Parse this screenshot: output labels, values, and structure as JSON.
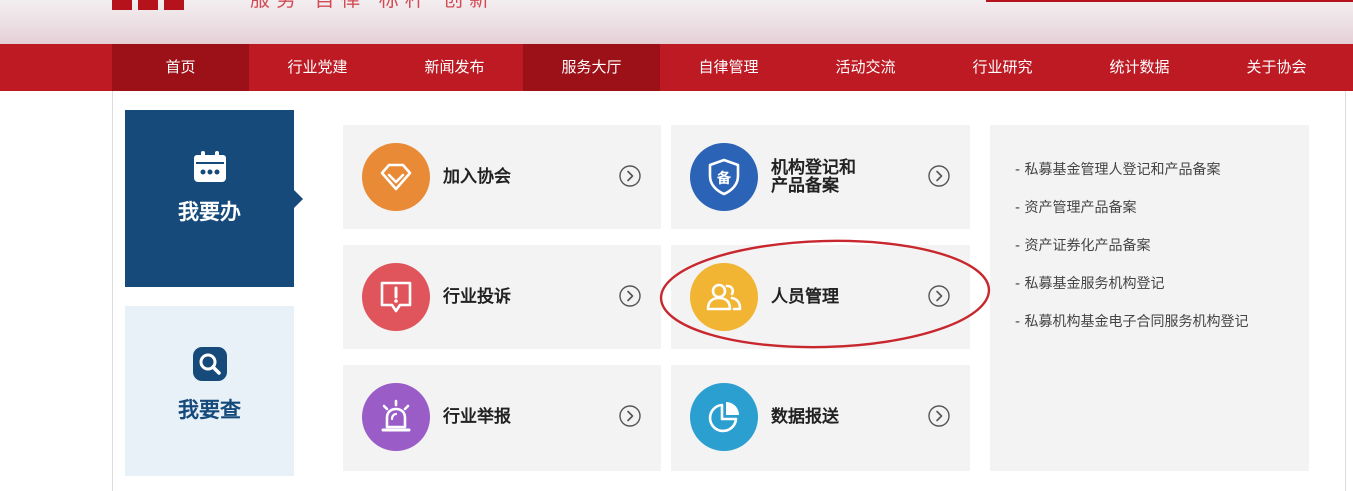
{
  "banner": {
    "slogan": "服务 自律 标杆 创新"
  },
  "nav": {
    "items": [
      {
        "label": "首页"
      },
      {
        "label": "行业党建"
      },
      {
        "label": "新闻发布"
      },
      {
        "label": "服务大厅"
      },
      {
        "label": "自律管理"
      },
      {
        "label": "活动交流"
      },
      {
        "label": "行业研究"
      },
      {
        "label": "统计数据"
      },
      {
        "label": "关于协会"
      }
    ]
  },
  "side_tabs": {
    "todo": {
      "label": "我要办",
      "icon": "calendar-icon"
    },
    "query": {
      "label": "我要查",
      "icon": "search-icon"
    }
  },
  "cards": {
    "join": {
      "label": "加入协会",
      "icon": "diamond-icon",
      "color": "#e98a37"
    },
    "registration": {
      "label_line1": "机构登记和",
      "label_line2": "产品备案",
      "icon": "shield-bei-icon",
      "color": "#2b63b6"
    },
    "complaint": {
      "label": "行业投诉",
      "icon": "alert-icon",
      "color": "#e0545b"
    },
    "personnel": {
      "label": "人员管理",
      "icon": "people-icon",
      "color": "#f1b433"
    },
    "report": {
      "label": "行业举报",
      "icon": "alarm-icon",
      "color": "#9a5cc6"
    },
    "data_submit": {
      "label": "数据报送",
      "icon": "pie-chart-icon",
      "color": "#2a9fd0"
    }
  },
  "links": [
    "- 私募基金管理人登记和产品备案",
    "- 资产管理产品备案",
    "- 资产证券化产品备案",
    "- 私募基金服务机构登记",
    "- 私募机构基金电子合同服务机构登记"
  ],
  "colors": {
    "nav_red": "#bd1a24",
    "nav_dark": "#9c1017",
    "sidebar_blue": "#164a7b",
    "annotation_red": "#c8272e"
  }
}
